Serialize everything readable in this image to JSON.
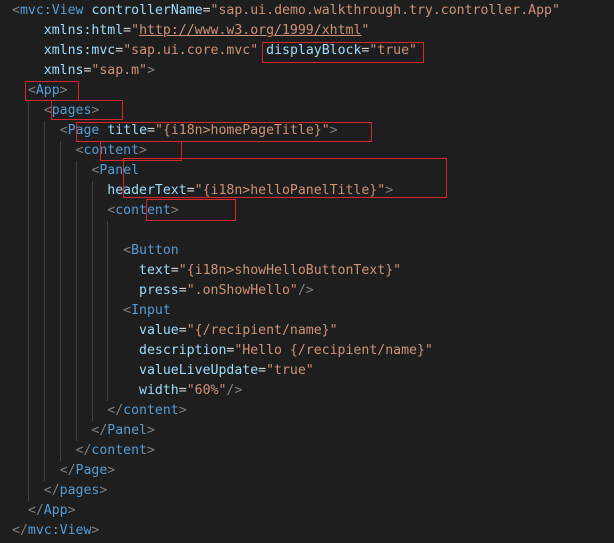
{
  "editor": {
    "lines": [
      [
        [
          "punct",
          "<"
        ],
        [
          "tag",
          "mvc:View"
        ],
        [
          "sp",
          " "
        ],
        [
          "attr",
          "controllerName"
        ],
        [
          "eq",
          "="
        ],
        [
          "str",
          "\"sap.ui.demo.walkthrough.try.controller.App\""
        ]
      ],
      [
        [
          "sp",
          "    "
        ],
        [
          "attr",
          "xmlns:html"
        ],
        [
          "eq",
          "="
        ],
        [
          "str",
          "\""
        ],
        [
          "link",
          "http://www.w3.org/1999/xhtml"
        ],
        [
          "str",
          "\""
        ]
      ],
      [
        [
          "sp",
          "    "
        ],
        [
          "attr",
          "xmlns:mvc"
        ],
        [
          "eq",
          "="
        ],
        [
          "str",
          "\"sap.ui.core.mvc\""
        ],
        [
          "sp",
          " "
        ],
        [
          "attr",
          "displayBlock"
        ],
        [
          "eq",
          "="
        ],
        [
          "str",
          "\"true\""
        ]
      ],
      [
        [
          "sp",
          "    "
        ],
        [
          "attr",
          "xmlns"
        ],
        [
          "eq",
          "="
        ],
        [
          "str",
          "\"sap.m\""
        ],
        [
          "punct",
          ">"
        ]
      ],
      [
        [
          "sp",
          "  "
        ],
        [
          "punct",
          "<"
        ],
        [
          "tag",
          "App"
        ],
        [
          "punct",
          ">"
        ]
      ],
      [
        [
          "sp",
          "    "
        ],
        [
          "punct",
          "<"
        ],
        [
          "tag",
          "pages"
        ],
        [
          "punct",
          ">"
        ]
      ],
      [
        [
          "sp",
          "      "
        ],
        [
          "punct",
          "<"
        ],
        [
          "tag",
          "Page"
        ],
        [
          "sp",
          " "
        ],
        [
          "attr",
          "title"
        ],
        [
          "eq",
          "="
        ],
        [
          "str",
          "\"{i18n>homePageTitle}\""
        ],
        [
          "punct",
          ">"
        ]
      ],
      [
        [
          "sp",
          "        "
        ],
        [
          "punct",
          "<"
        ],
        [
          "tag",
          "content"
        ],
        [
          "punct",
          ">"
        ]
      ],
      [
        [
          "sp",
          "          "
        ],
        [
          "punct",
          "<"
        ],
        [
          "tag",
          "Panel"
        ]
      ],
      [
        [
          "sp",
          "            "
        ],
        [
          "attr",
          "headerText"
        ],
        [
          "eq",
          "="
        ],
        [
          "str",
          "\"{i18n>helloPanelTitle}\""
        ],
        [
          "punct",
          ">"
        ]
      ],
      [
        [
          "sp",
          "            "
        ],
        [
          "punct",
          "<"
        ],
        [
          "tag",
          "content"
        ],
        [
          "punct",
          ">"
        ]
      ],
      [],
      [
        [
          "sp",
          "              "
        ],
        [
          "punct",
          "<"
        ],
        [
          "tag",
          "Button"
        ]
      ],
      [
        [
          "sp",
          "                "
        ],
        [
          "attr",
          "text"
        ],
        [
          "eq",
          "="
        ],
        [
          "str",
          "\"{i18n>showHelloButtonText}\""
        ]
      ],
      [
        [
          "sp",
          "                "
        ],
        [
          "attr",
          "press"
        ],
        [
          "eq",
          "="
        ],
        [
          "str",
          "\".onShowHello\""
        ],
        [
          "punct",
          "/>"
        ]
      ],
      [
        [
          "sp",
          "              "
        ],
        [
          "punct",
          "<"
        ],
        [
          "tag",
          "Input"
        ]
      ],
      [
        [
          "sp",
          "                "
        ],
        [
          "attr",
          "value"
        ],
        [
          "eq",
          "="
        ],
        [
          "str",
          "\"{/recipient/name}\""
        ]
      ],
      [
        [
          "sp",
          "                "
        ],
        [
          "attr",
          "description"
        ],
        [
          "eq",
          "="
        ],
        [
          "str",
          "\"Hello {/recipient/name}\""
        ]
      ],
      [
        [
          "sp",
          "                "
        ],
        [
          "attr",
          "valueLiveUpdate"
        ],
        [
          "eq",
          "="
        ],
        [
          "str",
          "\"true\""
        ]
      ],
      [
        [
          "sp",
          "                "
        ],
        [
          "attr",
          "width"
        ],
        [
          "eq",
          "="
        ],
        [
          "str",
          "\"60%\""
        ],
        [
          "punct",
          "/>"
        ]
      ],
      [
        [
          "sp",
          "            "
        ],
        [
          "punct",
          "</"
        ],
        [
          "tag",
          "content"
        ],
        [
          "punct",
          ">"
        ]
      ],
      [
        [
          "sp",
          "          "
        ],
        [
          "punct",
          "</"
        ],
        [
          "tag",
          "Panel"
        ],
        [
          "punct",
          ">"
        ]
      ],
      [
        [
          "sp",
          "        "
        ],
        [
          "punct",
          "</"
        ],
        [
          "tag",
          "content"
        ],
        [
          "punct",
          ">"
        ]
      ],
      [
        [
          "sp",
          "      "
        ],
        [
          "punct",
          "</"
        ],
        [
          "tag",
          "Page"
        ],
        [
          "punct",
          ">"
        ]
      ],
      [
        [
          "sp",
          "    "
        ],
        [
          "punct",
          "</"
        ],
        [
          "tag",
          "pages"
        ],
        [
          "punct",
          ">"
        ]
      ],
      [
        [
          "sp",
          "  "
        ],
        [
          "punct",
          "</"
        ],
        [
          "tag",
          "App"
        ],
        [
          "punct",
          ">"
        ]
      ],
      [
        [
          "punct",
          "</"
        ],
        [
          "tag",
          "mvc:View"
        ],
        [
          "punct",
          ">"
        ]
      ]
    ]
  }
}
